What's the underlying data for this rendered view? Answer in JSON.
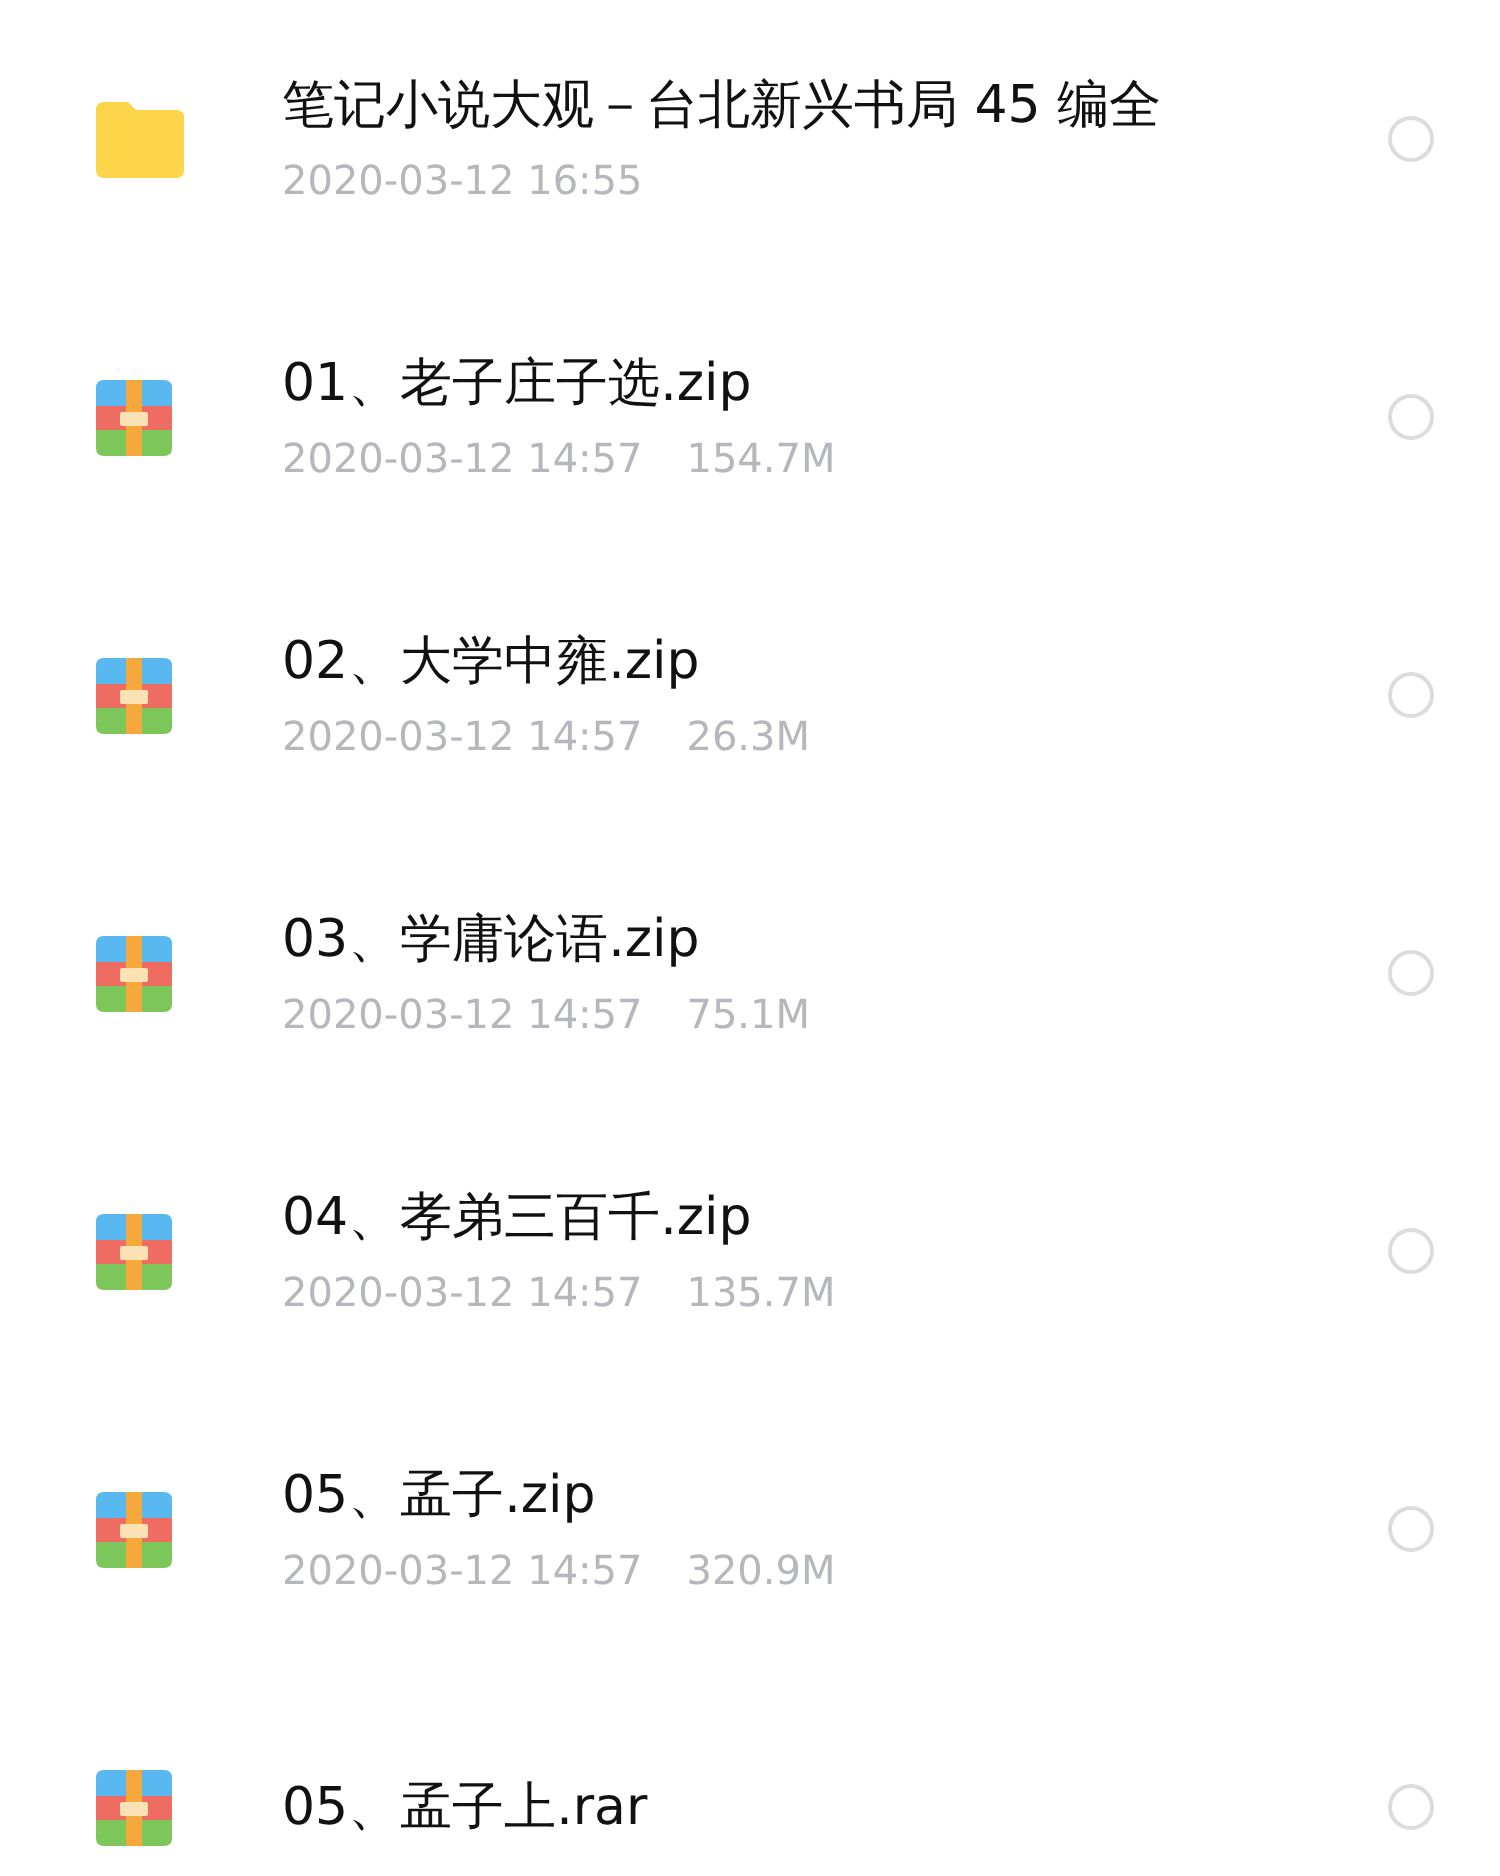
{
  "files": [
    {
      "kind": "folder",
      "name": "笔记小说大观－台北新兴书局 45 编全",
      "date": "2020-03-12 16:55",
      "selected": false
    },
    {
      "kind": "archive",
      "name": "01、老子庄子选.zip",
      "date": "2020-03-12 14:57",
      "size": "154.7M",
      "selected": false
    },
    {
      "kind": "archive",
      "name": "02、大学中雍.zip",
      "date": "2020-03-12 14:57",
      "size": "26.3M",
      "selected": false
    },
    {
      "kind": "archive",
      "name": "03、学庸论语.zip",
      "date": "2020-03-12 14:57",
      "size": "75.1M",
      "selected": false
    },
    {
      "kind": "archive",
      "name": "04、孝弟三百千.zip",
      "date": "2020-03-12 14:57",
      "size": "135.7M",
      "selected": false
    },
    {
      "kind": "archive",
      "name": "05、孟子.zip",
      "date": "2020-03-12 14:57",
      "size": "320.9M",
      "selected": false
    },
    {
      "kind": "archive",
      "name": "05、孟子上.rar",
      "selected": false
    }
  ]
}
